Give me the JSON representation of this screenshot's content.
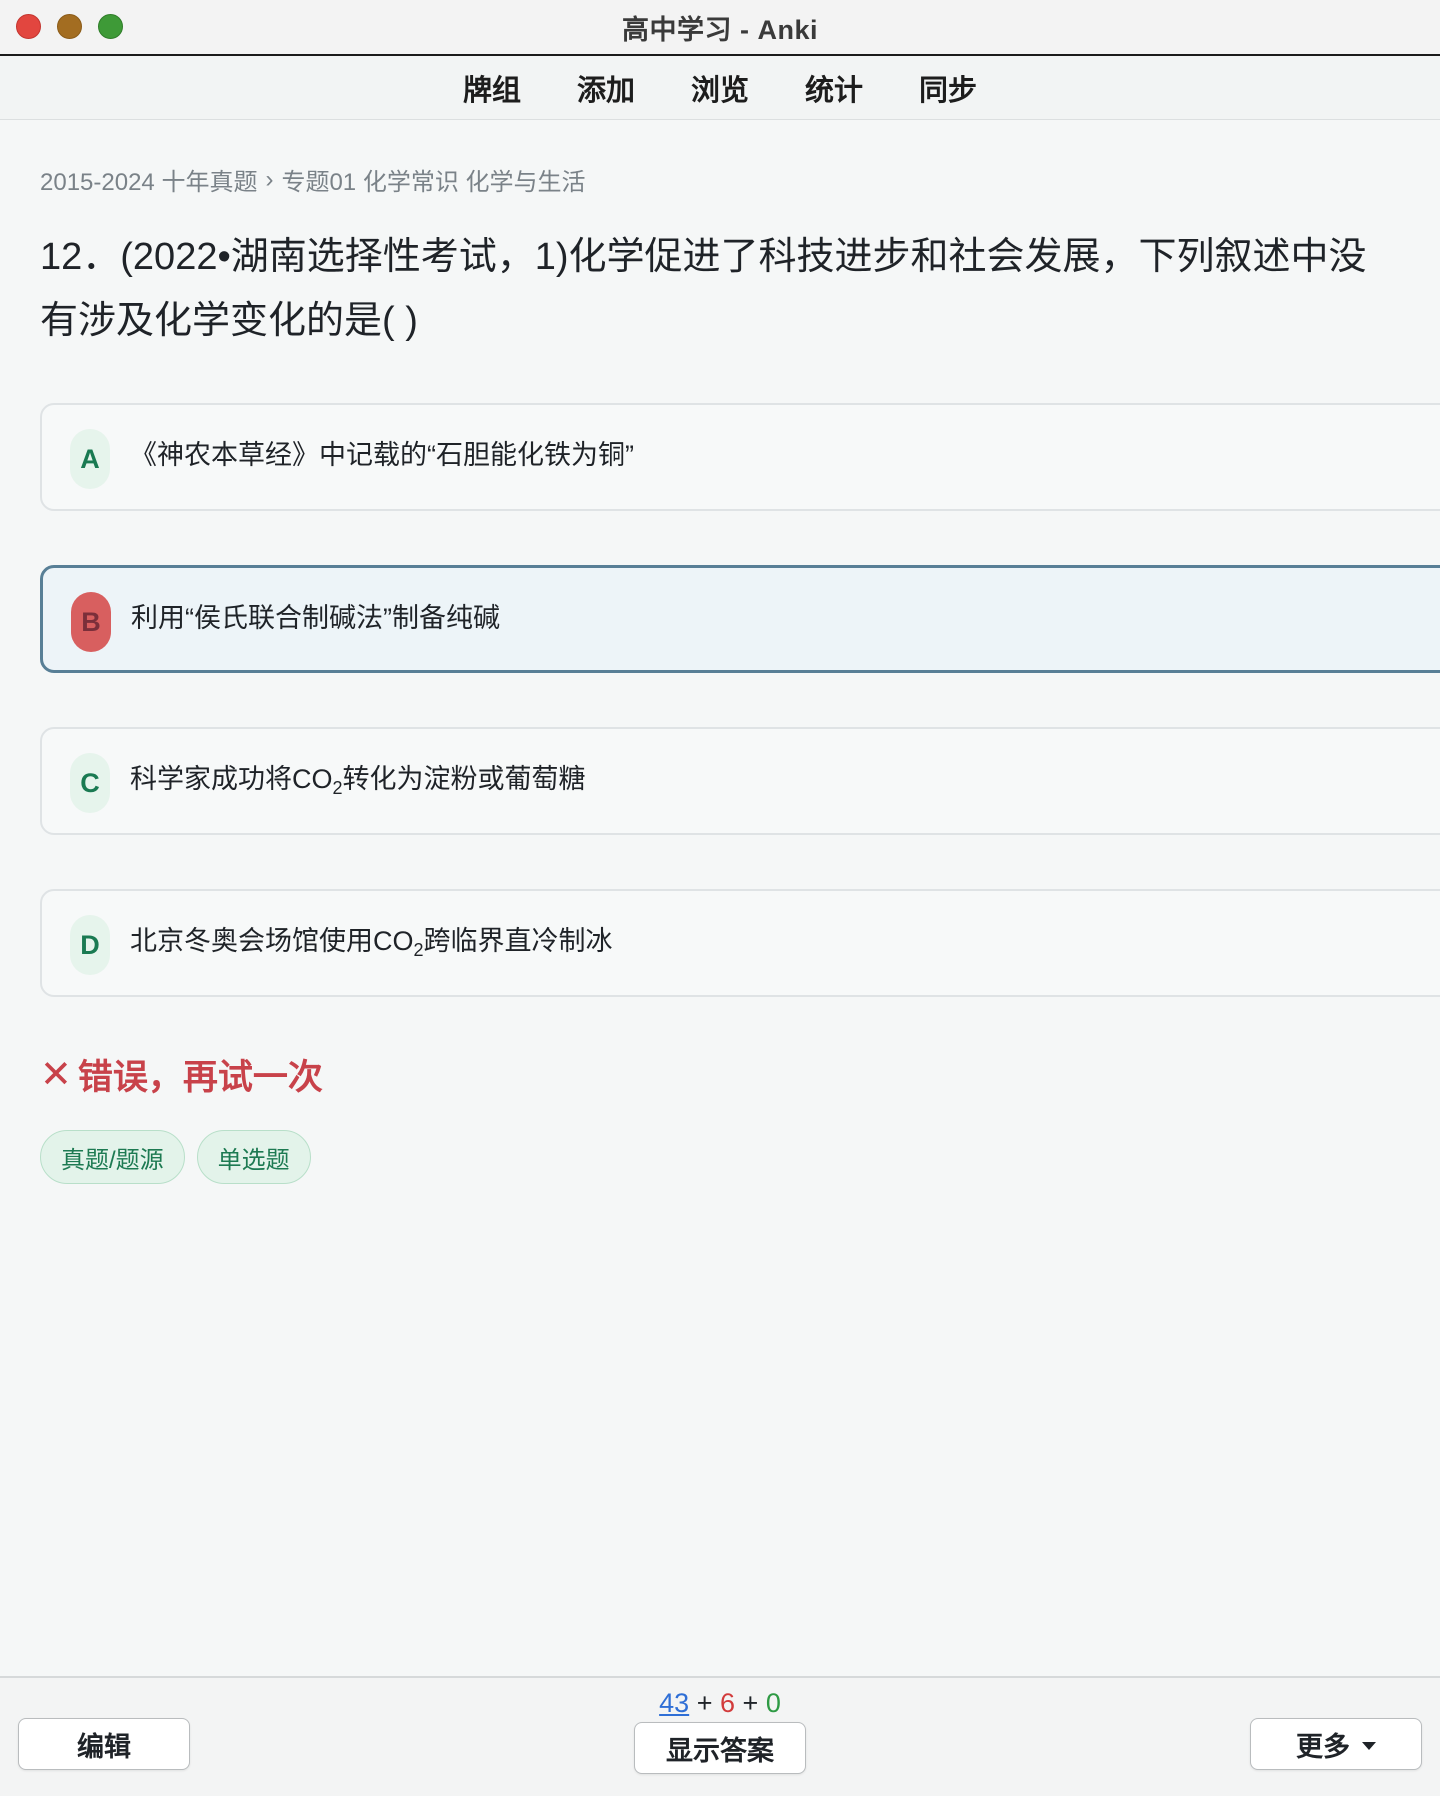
{
  "window": {
    "title": "高中学习 - Anki"
  },
  "nav": {
    "items": [
      "牌组",
      "添加",
      "浏览",
      "统计",
      "同步"
    ]
  },
  "breadcrumb": {
    "deck": "2015-2024 十年真题",
    "separator": "›",
    "subdeck": "专题01 化学常识 化学与生活"
  },
  "question": {
    "text": "12．(2022•湖南选择性考试，1)化学促进了科技进步和社会发展，下列叙述中没有涉及化学变化的是( )"
  },
  "options": [
    {
      "letter": "A",
      "text": "《神农本草经》中记载的“石胆能化铁为铜”",
      "selected": false
    },
    {
      "letter": "B",
      "text": "利用“侯氏联合制碱法”制备纯碱",
      "selected": true
    },
    {
      "letter": "C",
      "text_before": "科学家成功将CO",
      "sub": "2",
      "text_after": "转化为淀粉或葡萄糖",
      "selected": false
    },
    {
      "letter": "D",
      "text_before": "北京冬奥会场馆使用CO",
      "sub": "2",
      "text_after": "跨临界直冷制冰",
      "selected": false
    }
  ],
  "feedback": {
    "icon": "✕",
    "text": "错误，再试一次"
  },
  "tags": [
    "真题/题源",
    "单选题"
  ],
  "bottom": {
    "counts": {
      "new": "43",
      "plus1": "+",
      "learn": "6",
      "plus2": "+",
      "review": "0"
    },
    "edit_label": "编辑",
    "show_answer_label": "显示答案",
    "more_label": "更多"
  },
  "colors": {
    "accent": "#587f96",
    "error": "#c8424a",
    "tag_green": "#1d7a52",
    "new_count": "#2f6fd6",
    "learn_count": "#d23b3b",
    "review_count": "#2e9a44"
  }
}
